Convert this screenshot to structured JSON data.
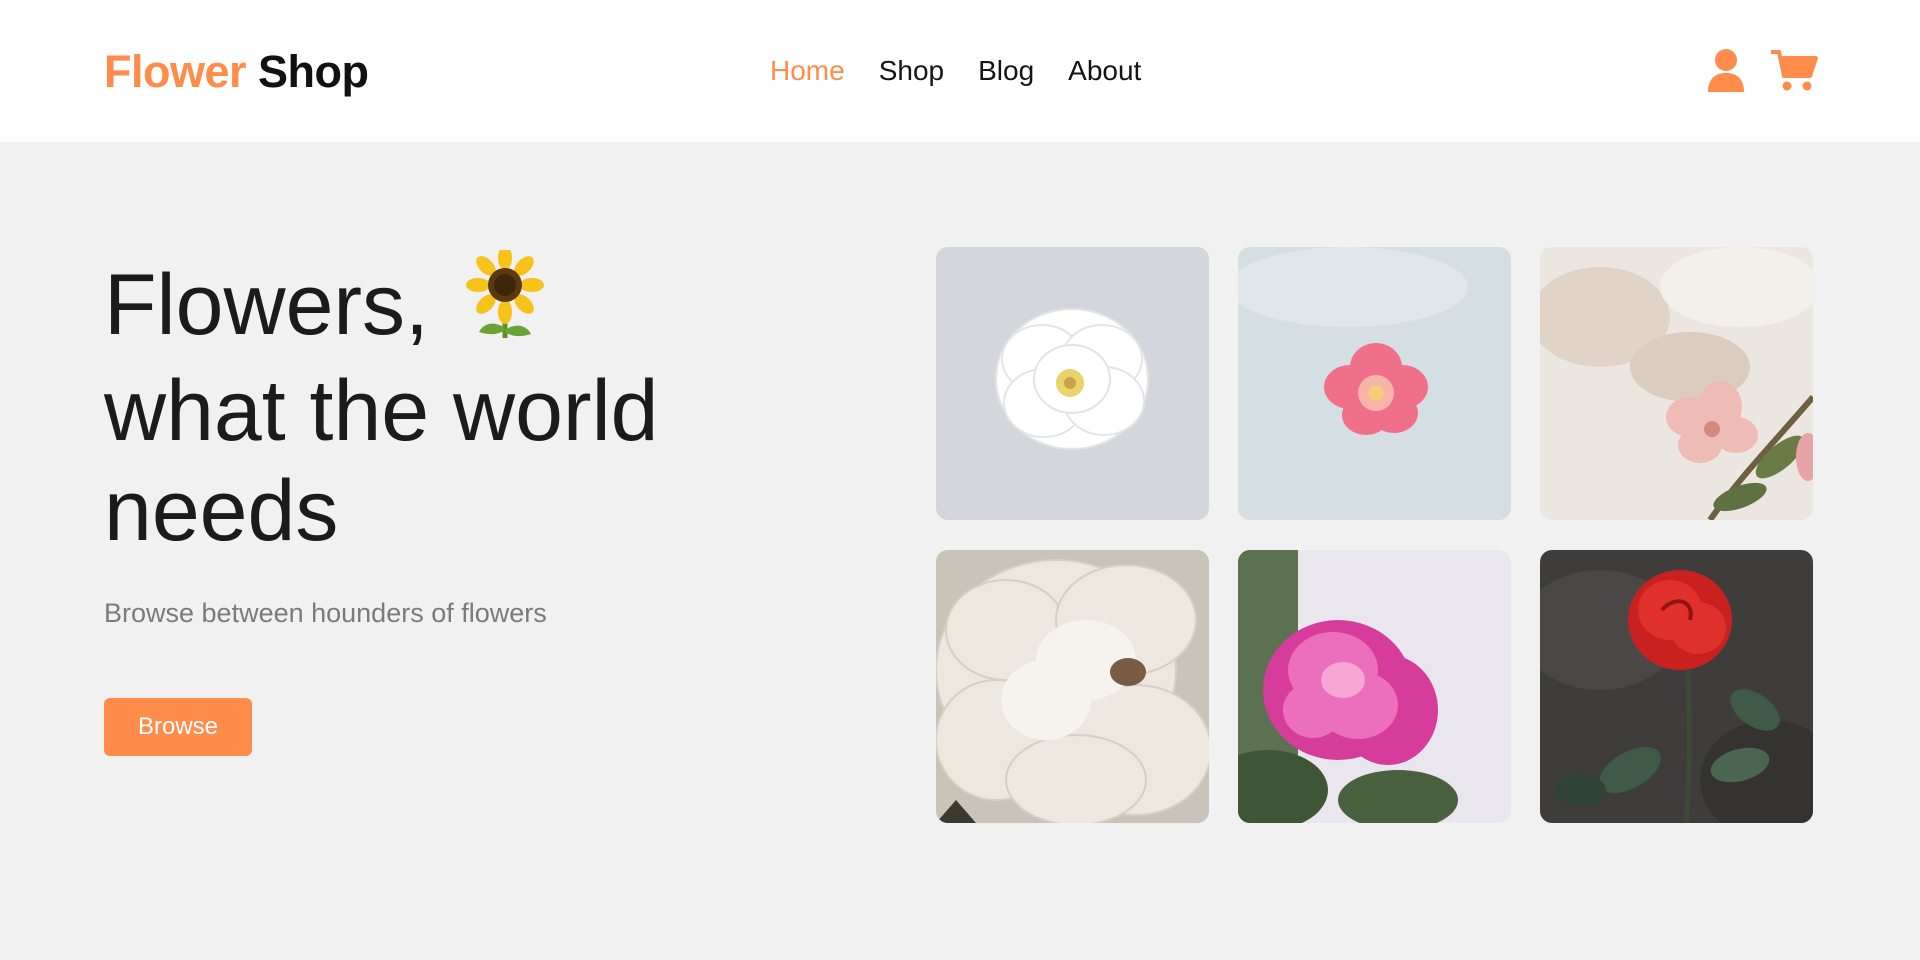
{
  "header": {
    "logo": {
      "part1": "Flower",
      "part2": "Shop"
    },
    "nav": [
      {
        "label": "Home",
        "active": true
      },
      {
        "label": "Shop",
        "active": false
      },
      {
        "label": "Blog",
        "active": false
      },
      {
        "label": "About",
        "active": false
      }
    ],
    "icons": [
      "user-icon",
      "cart-icon"
    ]
  },
  "hero": {
    "title_line1": "Flowers,",
    "title_line2": "what the world",
    "title_line3": "needs",
    "subtitle": "Browse between hounders of flowers",
    "button": "Browse"
  },
  "gallery": [
    "white-rose-image",
    "pink-flower-image",
    "blossom-image",
    "white-peony-image",
    "pink-peony-image",
    "red-rose-image"
  ],
  "colors": {
    "accent": "#ff8c4b",
    "background": "#f1f1f1",
    "header": "#ffffff"
  }
}
